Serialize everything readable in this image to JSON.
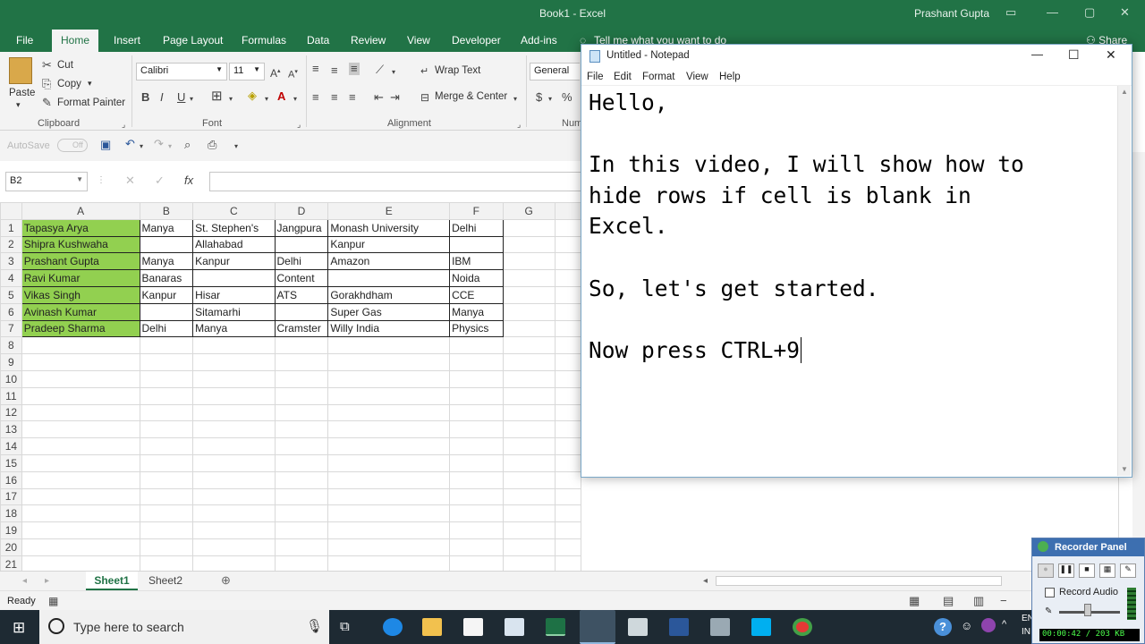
{
  "excel": {
    "title": "Book1 - Excel",
    "user": "Prashant Gupta",
    "share_label": "Share",
    "tell_me": "Tell me what you want to do",
    "tabs": [
      "File",
      "Home",
      "Insert",
      "Page Layout",
      "Formulas",
      "Data",
      "Review",
      "View",
      "Developer",
      "Add-ins"
    ],
    "active_tab": "Home",
    "ribbon": {
      "paste": "Paste",
      "cut": "Cut",
      "copy": "Copy",
      "format_painter": "Format Painter",
      "clipboard": "Clipboard",
      "font_name": "Calibri",
      "font_size": "11",
      "font": "Font",
      "wrap_text": "Wrap Text",
      "merge_center": "Merge & Center",
      "alignment": "Alignment",
      "number_format": "General",
      "number": "Num",
      "bold": "B",
      "italic": "I",
      "underline": "U"
    },
    "autosave": "AutoSave",
    "autosave_state": "Off",
    "name_box": "B2",
    "columns": [
      "A",
      "B",
      "C",
      "D",
      "E",
      "F",
      "G"
    ],
    "rows": [
      [
        "Tapasya Arya",
        "Manya",
        "St. Stephen's",
        "Jangpura",
        "Monash University",
        "Delhi"
      ],
      [
        "Shipra Kushwaha",
        "",
        "Allahabad",
        "",
        "Kanpur",
        ""
      ],
      [
        "Prashant Gupta",
        "Manya",
        "Kanpur",
        "Delhi",
        "Amazon",
        "IBM"
      ],
      [
        "Ravi Kumar",
        "Banaras",
        "",
        "Content",
        "",
        "Noida"
      ],
      [
        "Vikas Singh",
        "Kanpur",
        "Hisar",
        "ATS",
        "Gorakhdham",
        "CCE"
      ],
      [
        "Avinash Kumar",
        "",
        "Sitamarhi",
        "",
        "Super Gas",
        "Manya"
      ],
      [
        "Pradeep Sharma",
        "Delhi",
        "Manya",
        "Cramster",
        "Willy India",
        "Physics"
      ]
    ],
    "row_numbers": [
      "1",
      "2",
      "3",
      "4",
      "5",
      "6",
      "7",
      "8",
      "9",
      "10",
      "11",
      "12",
      "13",
      "14",
      "15",
      "16",
      "17",
      "18",
      "19",
      "20",
      "21"
    ],
    "sheets": [
      "Sheet1",
      "Sheet2"
    ],
    "active_sheet": "Sheet1",
    "status": "Ready"
  },
  "notepad": {
    "title": "Untitled - Notepad",
    "menu": [
      "File",
      "Edit",
      "Format",
      "View",
      "Help"
    ],
    "text": "Hello,\n\nIn this video, I will show how to\nhide rows if cell is blank in\nExcel.\n\nSo, let's get started.\n\nNow press CTRL+9"
  },
  "taskbar": {
    "search_placeholder": "Type here to search",
    "lang": "EN",
    "lang2": "IN"
  },
  "recorder": {
    "title": "Recorder Panel",
    "record_audio": "Record Audio",
    "status": "00:00:42 / 203 KB"
  },
  "colors": {
    "excel_green": "#217346",
    "highlight_green": "#92d050",
    "taskbar": "#1e2a33"
  }
}
